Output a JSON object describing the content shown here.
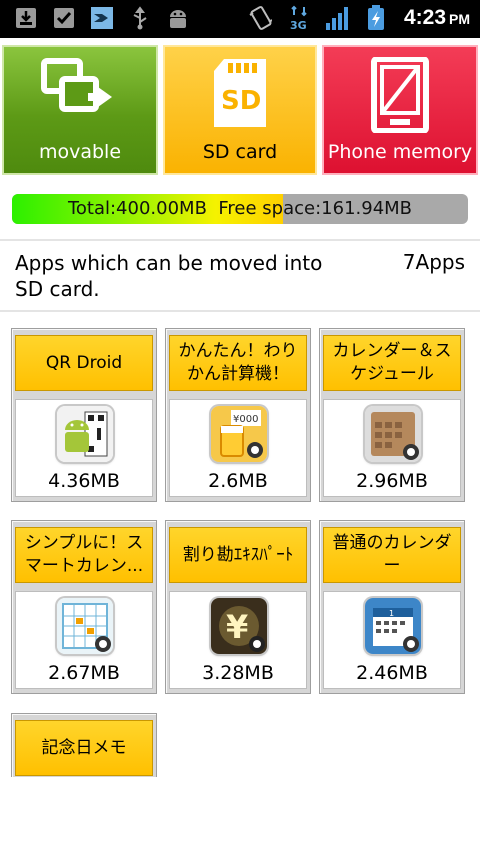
{
  "status_bar": {
    "time": "4:23",
    "ampm": "PM",
    "icons": [
      "download-icon",
      "checkbox-icon",
      "app-notify-icon",
      "usb-icon",
      "android-debug-icon",
      "vibrate-icon",
      "3g-data-icon",
      "signal-icon",
      "battery-charging-icon"
    ]
  },
  "tabs": [
    {
      "label": "movable",
      "color": "#5d9a16",
      "icon": "move-windows-icon"
    },
    {
      "label": "SD card",
      "color": "#fab200",
      "icon": "sd-card-icon"
    },
    {
      "label": "Phone memory",
      "color": "#dd1030",
      "icon": "phone-memory-icon"
    }
  ],
  "storage": {
    "total_label": "Total:400.00MB",
    "free_label": "Free space:161.94MB",
    "used_fraction": 0.595
  },
  "info": {
    "text": "Apps which can be moved into SD card.",
    "count": "7Apps"
  },
  "apps": [
    {
      "name": "QR Droid",
      "size": "4.36MB",
      "icon": "qr-droid-icon",
      "color": "#a4c639"
    },
    {
      "name": "かんたん！わりかん計算機！",
      "size": "2.6MB",
      "icon": "warikan-calculator-icon",
      "color": "#f2a400"
    },
    {
      "name": "カレンダー＆スケジュール",
      "size": "2.96MB",
      "icon": "calendar-schedule-icon",
      "color": "#a8784e"
    },
    {
      "name": "シンプルに！スマートカレン...",
      "size": "2.67MB",
      "icon": "smart-calendar-icon",
      "color": "#6fb4d8"
    },
    {
      "name": "割り勘ｴｷｽﾊﾟｰﾄ",
      "size": "3.28MB",
      "icon": "warikan-expert-icon",
      "color": "#4a3a22"
    },
    {
      "name": "普通のカレンダー",
      "size": "2.46MB",
      "icon": "normal-calendar-icon",
      "color": "#3d86c8"
    },
    {
      "name": "記念日メモ",
      "size": "",
      "icon": "anniversary-memo-icon",
      "color": "#ffc000"
    }
  ]
}
